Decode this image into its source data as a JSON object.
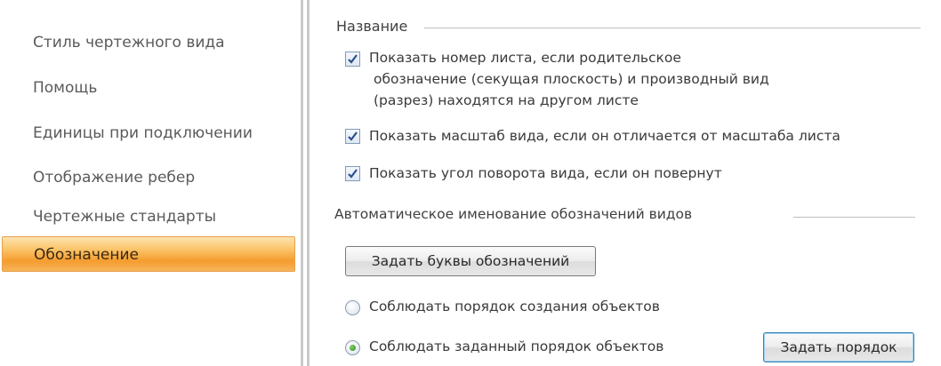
{
  "sidebar": {
    "items": [
      {
        "label": "Стиль чертежного вида"
      },
      {
        "label": "Помощь"
      },
      {
        "label": "Единицы при подключении"
      },
      {
        "label": "Отображение ребер"
      },
      {
        "label": "Чертежные стандарты"
      },
      {
        "label": "Обозначение",
        "active": true
      }
    ]
  },
  "naming": {
    "title": "Название",
    "options": [
      {
        "line1": "Показать номер листа, если родительское",
        "line2": "обозначение (секущая плоскость) и производный вид",
        "line3": "(разрез) находятся на другом листе",
        "checked": true
      },
      {
        "label": "Показать масштаб вида, если он отличается от масштаба листа",
        "checked": true
      },
      {
        "label": "Показать угол поворота вида, если он повернут",
        "checked": true
      }
    ]
  },
  "auto_naming": {
    "title": "Автоматическое именование обозначений видов",
    "set_letters_button": "Задать буквы обозначений",
    "radio_creation_order": "Соблюдать порядок создания объектов",
    "radio_custom_order": "Соблюдать заданный порядок объектов",
    "radio_selected": "custom_order",
    "set_order_button": "Задать порядок"
  },
  "colors": {
    "accent_active": "#f59c2f",
    "checkbox_border": "#7f9db9",
    "check_mark": "#2a4f8f",
    "radio_dot": "#2b8a1f"
  }
}
